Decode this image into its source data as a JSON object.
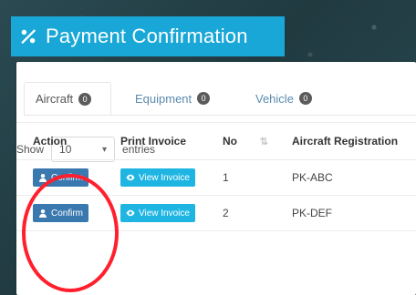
{
  "header": {
    "title": "Payment Confirmation",
    "icon": "percent-icon"
  },
  "tabs": [
    {
      "label": "Aircraft",
      "count": "0",
      "active": true
    },
    {
      "label": "Equipment",
      "count": "0",
      "active": false
    },
    {
      "label": "Vehicle",
      "count": "0",
      "active": false
    }
  ],
  "entries": {
    "show_label": "Show",
    "selected": "10",
    "entries_label": "entries"
  },
  "table": {
    "columns": [
      "Action",
      "Print Invoice",
      "No",
      "Aircraft Registration"
    ],
    "rows": [
      {
        "action": "Confirm",
        "invoice": "View Invoice",
        "no": "1",
        "registration": "PK-ABC"
      },
      {
        "action": "Confirm",
        "invoice": "View Invoice",
        "no": "2",
        "registration": "PK-DEF"
      }
    ]
  },
  "colors": {
    "header_bg": "#19a7d7",
    "confirm_bg": "#3a78b0",
    "view_bg": "#1fb5e3",
    "highlight": "#ff1f2d"
  }
}
